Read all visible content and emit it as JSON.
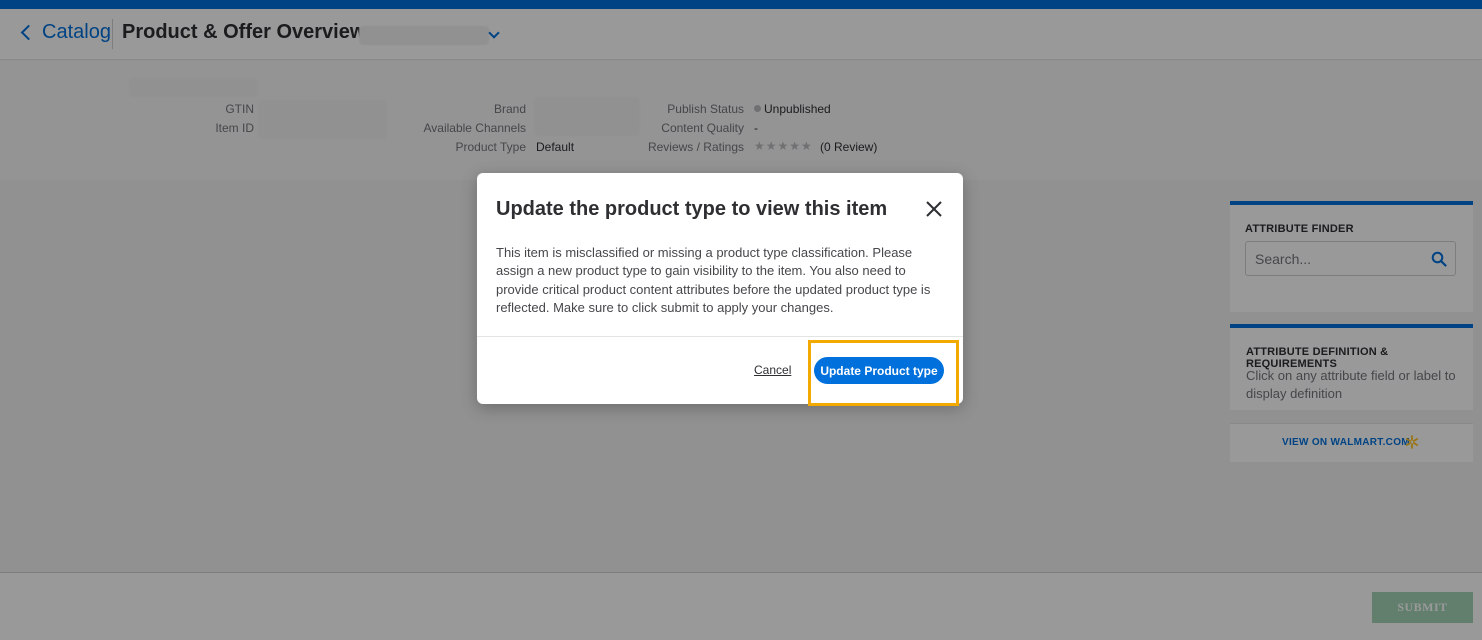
{
  "header": {
    "back_label": "Catalog",
    "title": "Product & Offer Overview:"
  },
  "summary": {
    "gtin_label": "GTIN",
    "item_id_label": "Item ID",
    "brand_label": "Brand",
    "channels_label": "Available Channels",
    "product_type_label": "Product Type",
    "product_type_value": "Default",
    "publish_status_label": "Publish Status",
    "publish_status_value": "Unpublished",
    "content_quality_label": "Content Quality",
    "content_quality_value": "-",
    "reviews_label": "Reviews / Ratings",
    "stars": "★★★★★",
    "rating": 0,
    "reviews_value": "(0 Review)"
  },
  "sidebar": {
    "attribute_finder_title": "ATTRIBUTE FINDER",
    "search_placeholder": "Search...",
    "definition_title": "ATTRIBUTE DEFINITION & REQUIREMENTS",
    "definition_text": "Click on any attribute field or label to display definition",
    "walmart_link": "VIEW ON WALMART.COM"
  },
  "footer": {
    "submit_label": "SUBMIT"
  },
  "modal": {
    "title": "Update the product type to view this item",
    "body": "This item is misclassified or missing a product type classification. Please assign a new product type to gain visibility to the item. You also need to provide critical product content attributes before the updated product type is reflected. Make sure to click submit to apply your changes.",
    "cancel_label": "Cancel",
    "update_label": "Update Product type"
  },
  "colors": {
    "brand_blue": "#0071dc",
    "highlight": "#f2a900",
    "submit_green": "#a3d4b8"
  }
}
